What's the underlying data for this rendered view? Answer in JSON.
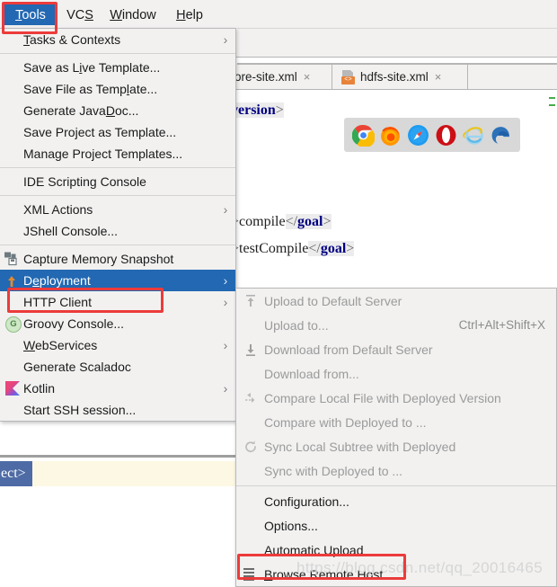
{
  "menubar": {
    "items": [
      {
        "id": "tools",
        "label": "Tools",
        "mnemonic": "T",
        "active": true
      },
      {
        "id": "vcs",
        "label": "VCS",
        "mnemonic": "S",
        "active": false
      },
      {
        "id": "window",
        "label": "Window",
        "mnemonic": "W",
        "active": false
      },
      {
        "id": "help",
        "label": "Help",
        "mnemonic": "H",
        "active": false
      }
    ]
  },
  "tools_menu": {
    "items": [
      {
        "label": "Tasks & Contexts",
        "icon": "none",
        "arrow": "›",
        "selected": false,
        "sep_after": true
      },
      {
        "label": "Save as Live Template...",
        "icon": "none",
        "arrow": "",
        "selected": false
      },
      {
        "label": "Save File as Template...",
        "icon": "none",
        "arrow": "",
        "selected": false
      },
      {
        "label": "Generate JavaDoc...",
        "icon": "none",
        "arrow": "",
        "selected": false
      },
      {
        "label": "Save Project as Template...",
        "icon": "none",
        "arrow": "",
        "selected": false
      },
      {
        "label": "Manage Project Templates...",
        "icon": "none",
        "arrow": "",
        "selected": false,
        "sep_after": true
      },
      {
        "label": "IDE Scripting Console",
        "icon": "none",
        "arrow": "",
        "selected": false,
        "sep_after": true
      },
      {
        "label": "XML Actions",
        "icon": "none",
        "arrow": "›",
        "selected": false
      },
      {
        "label": "JShell Console...",
        "icon": "none",
        "arrow": "",
        "selected": false,
        "sep_after": true
      },
      {
        "label": "Capture Memory Snapshot",
        "icon": "capture-memory-icon",
        "arrow": "",
        "selected": false
      },
      {
        "label": "Deployment",
        "icon": "deployment-upload-icon",
        "arrow": "›",
        "selected": true
      },
      {
        "label": "HTTP Client",
        "icon": "none",
        "arrow": "›",
        "selected": false
      },
      {
        "label": "Groovy Console...",
        "icon": "groovy-icon",
        "arrow": "",
        "selected": false
      },
      {
        "label": "WebServices",
        "icon": "none",
        "arrow": "›",
        "selected": false
      },
      {
        "label": "Generate Scaladoc",
        "icon": "none",
        "arrow": "",
        "selected": false
      },
      {
        "label": "Kotlin",
        "icon": "kotlin-icon",
        "arrow": "›",
        "selected": false
      },
      {
        "label": "Start SSH session...",
        "icon": "none",
        "arrow": "",
        "selected": false
      }
    ]
  },
  "deployment_submenu": {
    "items": [
      {
        "label": "Upload to Default Server",
        "icon": "upload-icon",
        "shortcut": "",
        "disabled": true
      },
      {
        "label": "Upload to...",
        "icon": "none",
        "shortcut": "Ctrl+Alt+Shift+X",
        "disabled": true
      },
      {
        "label": "Download from Default Server",
        "icon": "download-icon",
        "shortcut": "",
        "disabled": true
      },
      {
        "label": "Download from...",
        "icon": "none",
        "shortcut": "",
        "disabled": true
      },
      {
        "label": "Compare Local File with Deployed Version",
        "icon": "compare-icon",
        "shortcut": "",
        "disabled": true
      },
      {
        "label": "Compare with Deployed to ...",
        "icon": "none",
        "shortcut": "",
        "disabled": true
      },
      {
        "label": "Sync Local Subtree with Deployed",
        "icon": "sync-icon",
        "shortcut": "",
        "disabled": true
      },
      {
        "label": "Sync with Deployed to ...",
        "icon": "none",
        "shortcut": "",
        "disabled": true,
        "sep_after": true
      },
      {
        "label": "Configuration...",
        "icon": "none",
        "shortcut": "",
        "disabled": false
      },
      {
        "label": "Options...",
        "icon": "none",
        "shortcut": "",
        "disabled": false
      },
      {
        "label": "Automatic Upload",
        "icon": "none",
        "shortcut": "",
        "disabled": false
      },
      {
        "label": "Browse Remote Host",
        "icon": "browse-remote-host-icon",
        "shortcut": "",
        "disabled": false
      }
    ]
  },
  "editor": {
    "tabs": [
      {
        "label": "ore-site.xml",
        "icon": "none",
        "close": "×",
        "active": false
      },
      {
        "label": "hdfs-site.xml",
        "icon": "xml-file-icon",
        "close": "×",
        "active": true
      }
    ],
    "code_lines": [
      {
        "prefix": "",
        "tag": "version",
        "suffix": ">"
      },
      {
        "prefix": ">compile",
        "tag": "goal",
        "suffix": ">"
      },
      {
        "prefix": ">testCompile",
        "tag": "goal",
        "suffix": ">"
      }
    ],
    "selected_text": "ect>"
  },
  "browser_popup": {
    "icons": [
      {
        "name": "chrome-icon",
        "color": "#4285f4"
      },
      {
        "name": "firefox-icon",
        "color": "#e66000"
      },
      {
        "name": "safari-icon",
        "color": "#1d9bf0"
      },
      {
        "name": "opera-icon",
        "color": "#cc0f16"
      },
      {
        "name": "internet-explorer-icon",
        "color": "#57b0e5"
      },
      {
        "name": "edge-icon",
        "color": "#2c72b8"
      }
    ]
  },
  "annotations": {
    "watermark": "https://blog.csdn.net/qq_20016465",
    "highlight_color": "#ec3b3b",
    "selection_color": "#2268b2"
  }
}
